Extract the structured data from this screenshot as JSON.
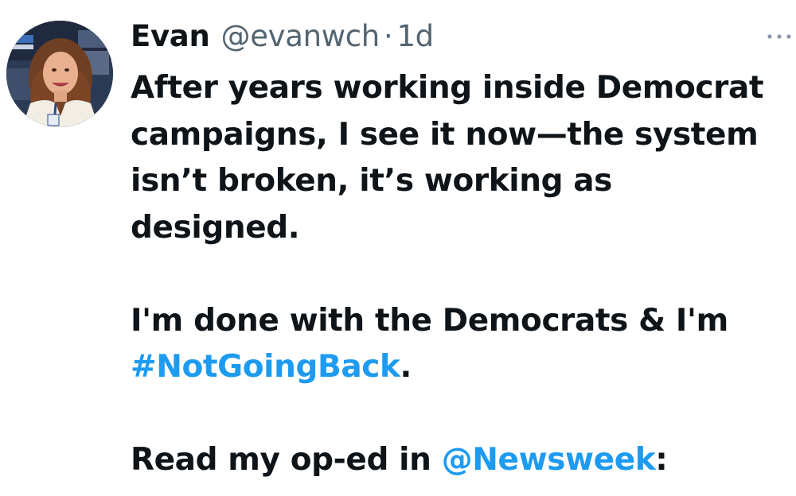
{
  "tweet": {
    "author": {
      "display_name": "Evan",
      "handle": "@evanwch",
      "avatar_icon": "user-avatar"
    },
    "separator": "·",
    "timestamp": "1d",
    "more_icon": "more-horizontal-icon",
    "body": {
      "paragraph1_lines": [
        "After years working inside Democrat",
        "campaigns, I see it now—the system",
        "isn’t broken, it’s working as",
        "designed."
      ],
      "paragraph2_line1": "I'm done with the Democrats & I'm",
      "hashtag": "#NotGoingBack",
      "hashtag_trailing": ".",
      "paragraph3_text": "Read my op-ed in ",
      "mention": "@Newsweek",
      "mention_trailing": ":"
    }
  },
  "colors": {
    "text_primary": "#0f1419",
    "text_secondary": "#536471",
    "link": "#1d9bf0",
    "background": "#ffffff"
  }
}
